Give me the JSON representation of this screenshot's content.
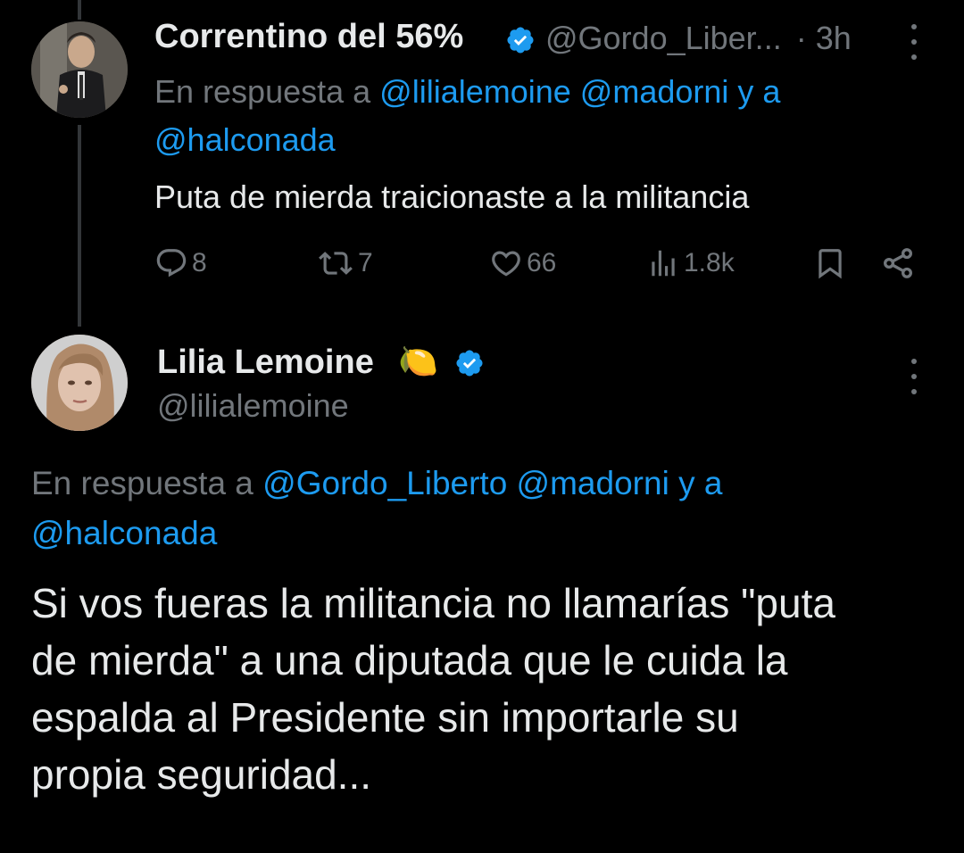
{
  "reply_tweet": {
    "author_name": "Correntino del 56%",
    "author_handle": "@Gordo_Liber...",
    "separator": "·",
    "time": "3h",
    "reply_prefix": "En respuesta a",
    "reply_mentions_line1": "@lilialemoine @madorni y a",
    "reply_mentions_line2": "@halconada",
    "text": "Puta de mierda traicionaste a la militancia",
    "actions": {
      "replies": "8",
      "retweets": "7",
      "likes": "66",
      "views": "1.8k"
    }
  },
  "main_tweet": {
    "author_name": "Lilia Lemoine",
    "author_emoji": "🍋",
    "author_handle": "@lilialemoine",
    "reply_prefix": "En respuesta a",
    "reply_mentions_line1": "@Gordo_Liberto @madorni y a",
    "reply_mentions_line2": "@halconada",
    "text_lines": [
      "Si vos fueras la militancia no llamarías \"puta",
      "de mierda\" a una diputada que le cuida la",
      "espalda al Presidente sin importarle su",
      "propia seguridad..."
    ]
  },
  "colors": {
    "background": "#000000",
    "text": "#e7e9ea",
    "muted": "#71767b",
    "link": "#1d9bf0",
    "verified": "#1d9bf0"
  },
  "icons": [
    "verified-badge-icon",
    "more-options-icon",
    "reply-icon",
    "retweet-icon",
    "like-icon",
    "views-icon",
    "bookmark-icon",
    "share-icon",
    "lemon-emoji-icon"
  ]
}
